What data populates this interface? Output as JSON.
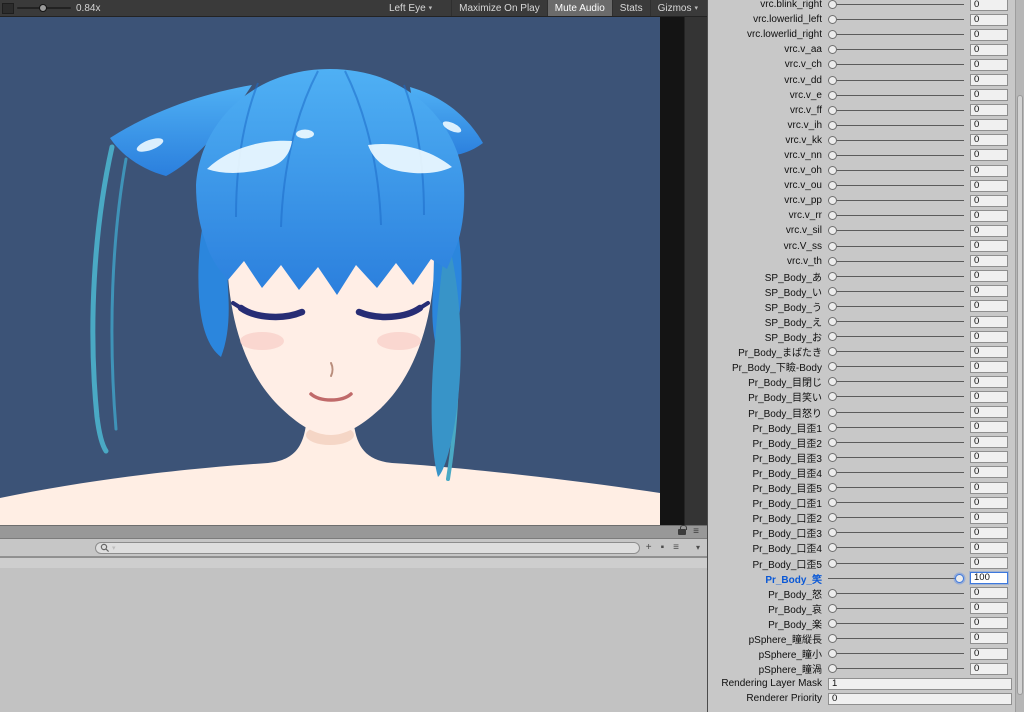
{
  "colors": {
    "game_background": "#3c5377",
    "hair_blue": "#2f8fe6",
    "skin": "#ffeee4",
    "selection_blue": "#0a58d6",
    "field_focus_blue": "#3d78dd",
    "toolbar_dark": "#3a3a3a",
    "panel_gray": "#c8c8c8"
  },
  "game_toolbar": {
    "scale_label": "0.84x",
    "display_target": "Left Eye",
    "maximize_label": "Maximize On Play",
    "mute_label": "Mute Audio",
    "mute_active": true,
    "stats_label": "Stats",
    "gizmos_label": "Gizmos"
  },
  "game_view": {
    "alt": "anime girl portrait, blue hair with cat-ear tufts, closed eyes, smiling, bare shoulders"
  },
  "bottom_panel": {
    "search_value": ""
  },
  "icons": {
    "caret": "▾",
    "menu": "≡",
    "plus": "+",
    "block": "▪"
  },
  "inspector": {
    "blendshapes": [
      {
        "label": "vrc.blink_right",
        "value": 0
      },
      {
        "label": "vrc.lowerlid_left",
        "value": 0
      },
      {
        "label": "vrc.lowerlid_right",
        "value": 0
      },
      {
        "label": "vrc.v_aa",
        "value": 0
      },
      {
        "label": "vrc.v_ch",
        "value": 0
      },
      {
        "label": "vrc.v_dd",
        "value": 0
      },
      {
        "label": "vrc.v_e",
        "value": 0
      },
      {
        "label": "vrc.v_ff",
        "value": 0
      },
      {
        "label": "vrc.v_ih",
        "value": 0
      },
      {
        "label": "vrc.v_kk",
        "value": 0
      },
      {
        "label": "vrc.v_nn",
        "value": 0
      },
      {
        "label": "vrc.v_oh",
        "value": 0
      },
      {
        "label": "vrc.v_ou",
        "value": 0
      },
      {
        "label": "vrc.v_pp",
        "value": 0
      },
      {
        "label": "vrc.v_rr",
        "value": 0
      },
      {
        "label": "vrc.v_sil",
        "value": 0
      },
      {
        "label": "vrc.V_ss",
        "value": 0
      },
      {
        "label": "vrc.v_th",
        "value": 0
      },
      {
        "label": "SP_Body_あ",
        "value": 0
      },
      {
        "label": "SP_Body_い",
        "value": 0
      },
      {
        "label": "SP_Body_う",
        "value": 0
      },
      {
        "label": "SP_Body_え",
        "value": 0
      },
      {
        "label": "SP_Body_お",
        "value": 0
      },
      {
        "label": "Pr_Body_まばたき",
        "value": 0
      },
      {
        "label": "Pr_Body_下瞼-Body",
        "value": 0
      },
      {
        "label": "Pr_Body_目閉じ",
        "value": 0
      },
      {
        "label": "Pr_Body_目笑い",
        "value": 0
      },
      {
        "label": "Pr_Body_目怒り",
        "value": 0
      },
      {
        "label": "Pr_Body_目歪1",
        "value": 0
      },
      {
        "label": "Pr_Body_目歪2",
        "value": 0
      },
      {
        "label": "Pr_Body_目歪3",
        "value": 0
      },
      {
        "label": "Pr_Body_目歪4",
        "value": 0
      },
      {
        "label": "Pr_Body_目歪5",
        "value": 0
      },
      {
        "label": "Pr_Body_口歪1",
        "value": 0
      },
      {
        "label": "Pr_Body_口歪2",
        "value": 0
      },
      {
        "label": "Pr_Body_口歪3",
        "value": 0
      },
      {
        "label": "Pr_Body_口歪4",
        "value": 0
      },
      {
        "label": "Pr_Body_口歪5",
        "value": 0
      },
      {
        "label": "Pr_Body_笑",
        "value": 100,
        "selected": true
      },
      {
        "label": "Pr_Body_怒",
        "value": 0
      },
      {
        "label": "Pr_Body_哀",
        "value": 0
      },
      {
        "label": "Pr_Body_楽",
        "value": 0
      },
      {
        "label": "pSphere_瞳縦長",
        "value": 0
      },
      {
        "label": "pSphere_瞳小",
        "value": 0
      },
      {
        "label": "pSphere_瞳渦",
        "value": 0
      }
    ],
    "properties": [
      {
        "label": "Rendering Layer Mask",
        "value": "1"
      },
      {
        "label": "Renderer Priority",
        "value": "0"
      }
    ]
  }
}
